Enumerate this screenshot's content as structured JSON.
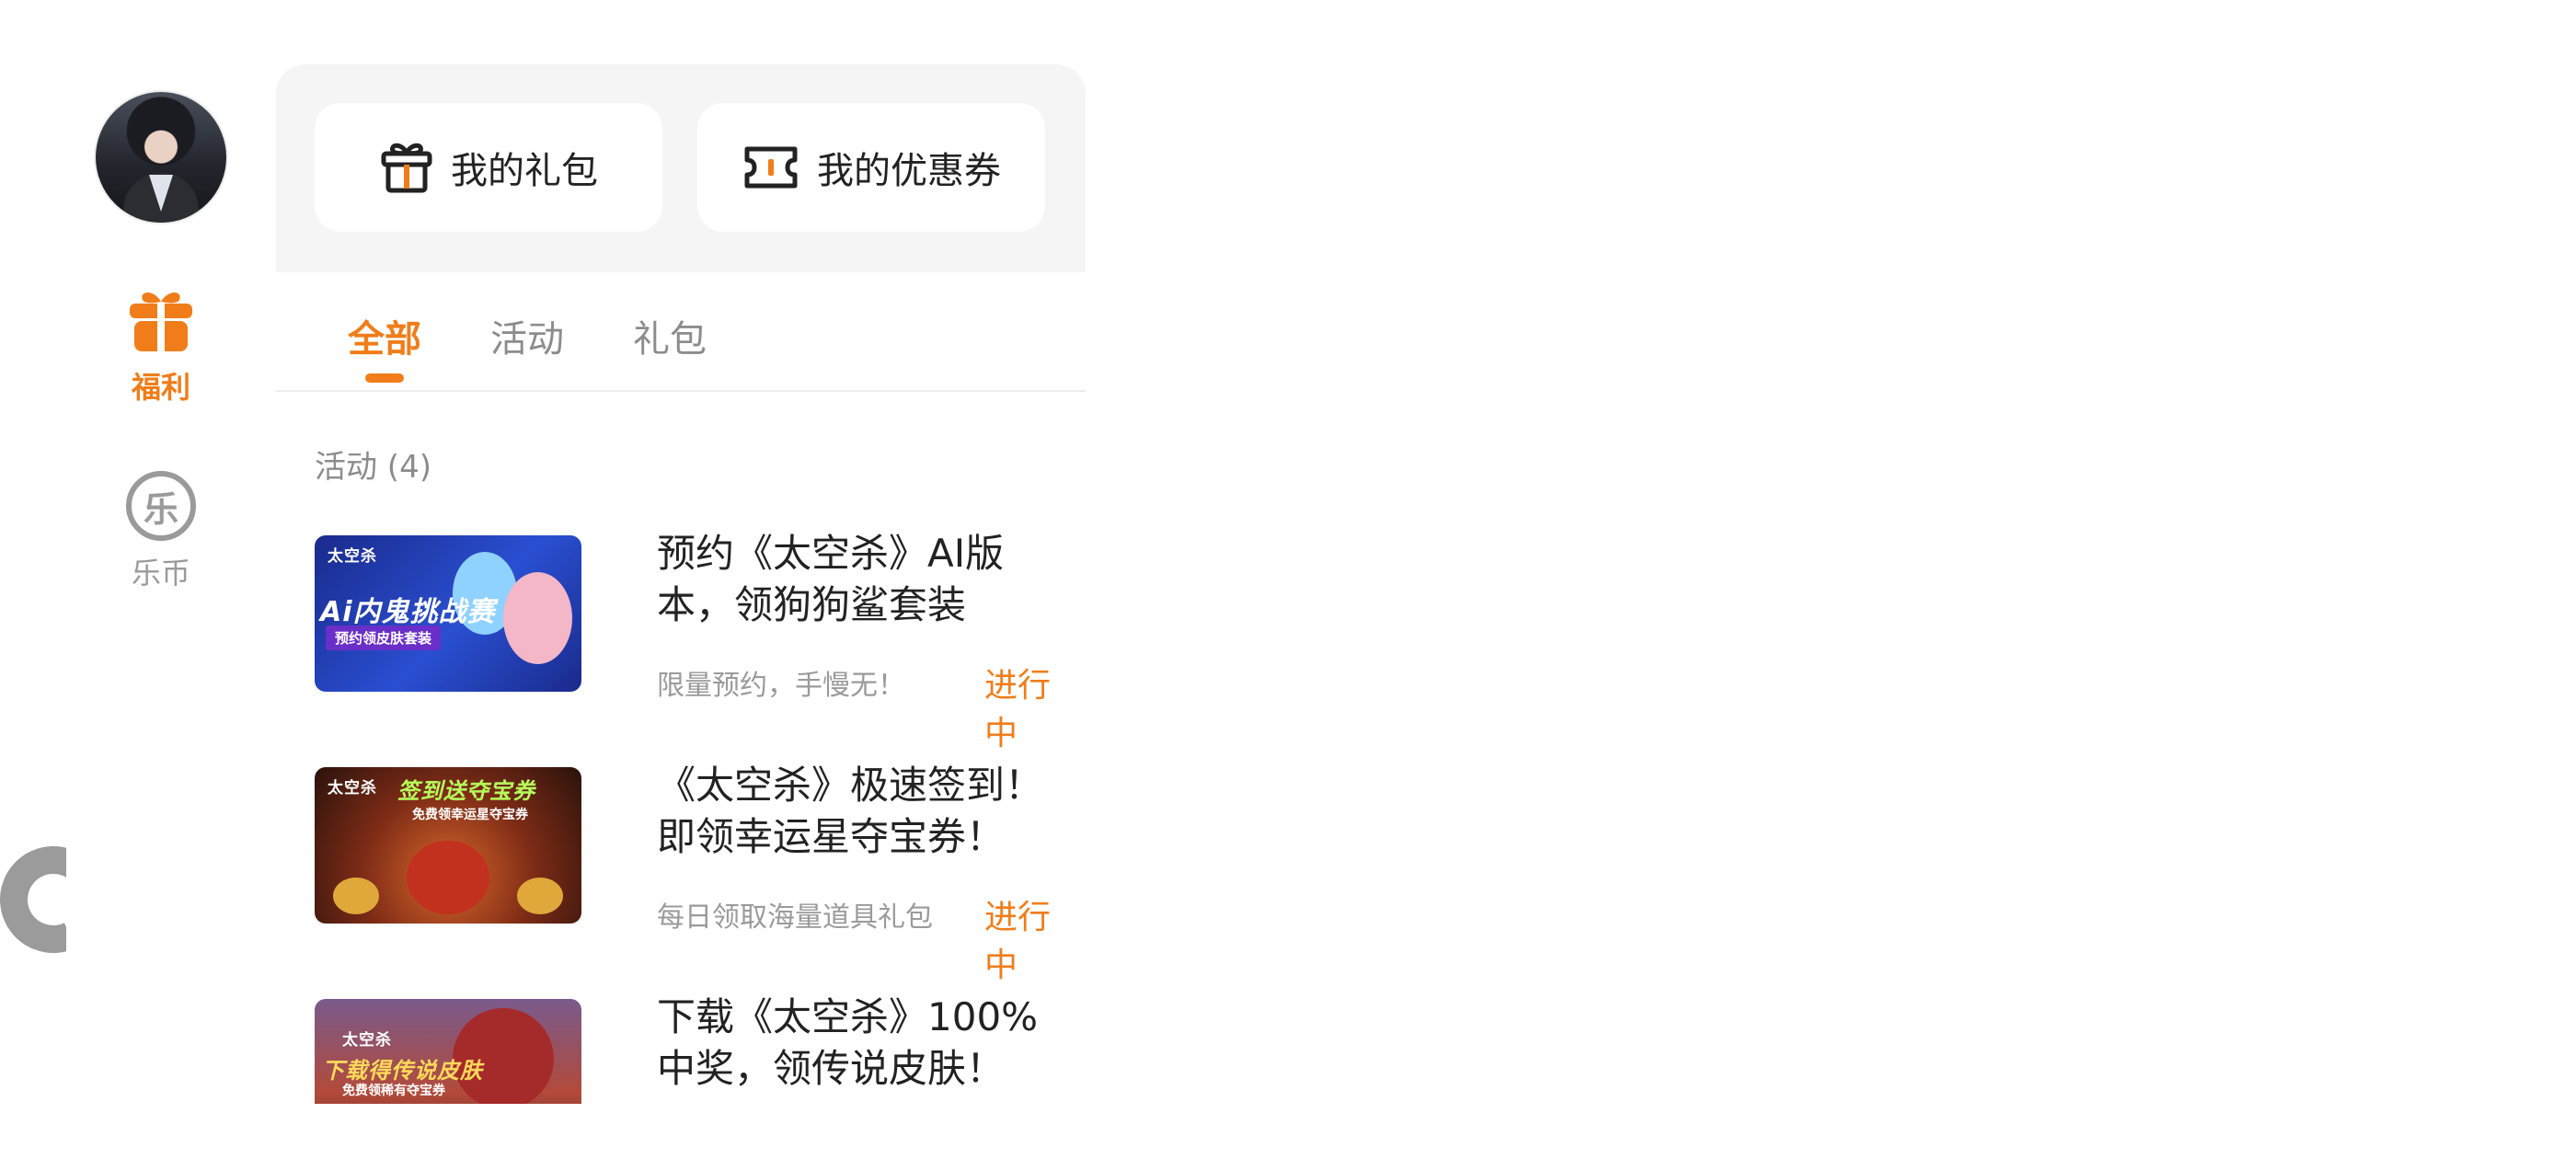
{
  "colors": {
    "accent": "#f07d1a",
    "muted": "#9a9a9a",
    "card_bg": "#f5f5f5"
  },
  "nav": {
    "items": [
      {
        "label": "福利",
        "icon": "gift-icon",
        "active": true
      },
      {
        "label": "乐币",
        "icon": "coin-icon",
        "glyph": "乐",
        "active": false
      }
    ]
  },
  "quick_actions": [
    {
      "label": "我的礼包",
      "icon": "gift-box-icon"
    },
    {
      "label": "我的优惠券",
      "icon": "ticket-icon"
    }
  ],
  "tabs": [
    {
      "label": "全部",
      "active": true
    },
    {
      "label": "活动",
      "active": false
    },
    {
      "label": "礼包",
      "active": false
    }
  ],
  "section": {
    "title": "活动 (4)"
  },
  "activities": [
    {
      "title": "预约《太空杀》AI版本，领狗狗鲨套装",
      "desc": "限量预约，手慢无！",
      "status": "进行中",
      "thumb_logo": "太空杀",
      "thumb_banner": "Ai内鬼挑战赛",
      "thumb_sub": "预约领皮肤套装"
    },
    {
      "title": "《太空杀》极速签到！即领幸运星夺宝券！",
      "desc": "每日领取海量道具礼包",
      "status": "进行中",
      "thumb_logo": "太空杀",
      "thumb_banner": "签到送夺宝券",
      "thumb_sub": "免费领幸运星夺宝券"
    },
    {
      "title": "下载《太空杀》100%中奖，领传说皮肤！",
      "thumb_logo": "太空杀",
      "thumb_banner": "下载得传说皮肤",
      "thumb_sub": "免费领稀有夺宝券"
    }
  ]
}
